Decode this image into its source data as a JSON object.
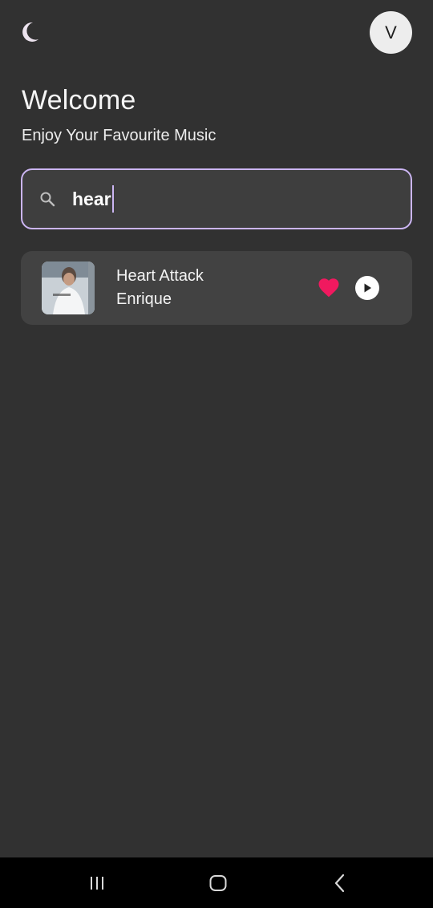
{
  "header": {
    "theme_icon": "moon-icon",
    "avatar_initial": "V"
  },
  "hero": {
    "title": "Welcome",
    "subtitle": "Enjoy Your Favourite Music"
  },
  "search": {
    "icon": "search-icon",
    "value": "hear",
    "accent_color": "#cbb5f2"
  },
  "results": [
    {
      "title": "Heart Attack",
      "artist": "Enrique",
      "favorite": true,
      "favorite_color": "#f0195f",
      "play_icon": "play-icon"
    }
  ],
  "nav_bar": {
    "recents_icon": "recents-icon",
    "home_icon": "home-icon",
    "back_icon": "back-icon"
  },
  "colors": {
    "background": "#313131",
    "card": "#424242",
    "search_field": "#3e3e3e"
  }
}
